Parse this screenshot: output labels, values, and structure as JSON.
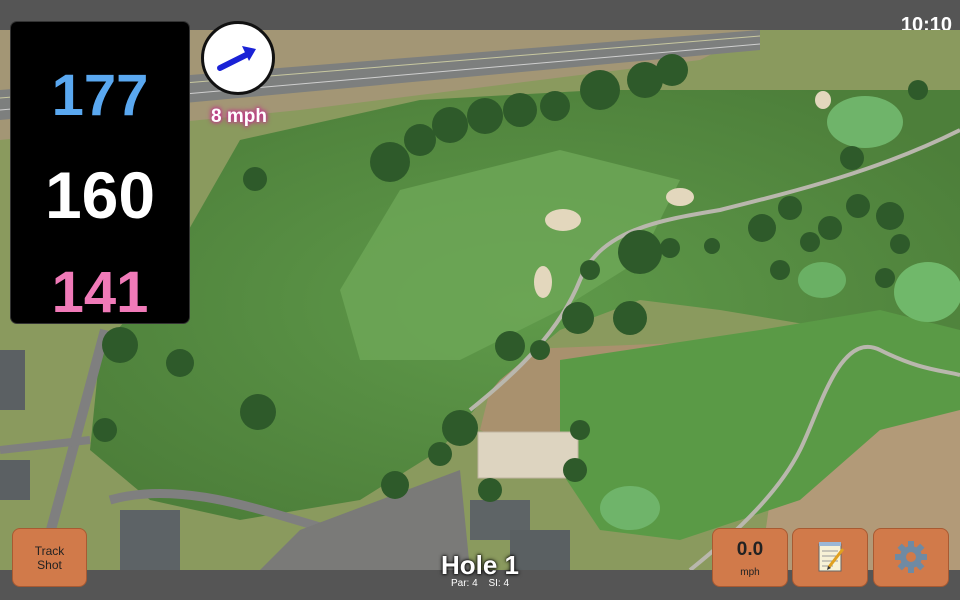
{
  "status": {
    "time": "10:10"
  },
  "distances": {
    "back": "177",
    "middle": "160",
    "front": "141"
  },
  "wind": {
    "speed_text": "8 mph",
    "direction_icon": "arrow-icon",
    "arrow_color": "#1a22d6"
  },
  "buttons": {
    "track_shot_label": "Track\nShot",
    "speed_value": "0.0",
    "speed_unit": "mph",
    "notes_icon": "notepad-icon",
    "settings_icon": "gear-icon"
  },
  "hole": {
    "title": "Hole 1",
    "par": "Par: 4",
    "si": "SI: 4"
  },
  "colors": {
    "back": "#5aa8f0",
    "middle": "#ffffff",
    "front": "#f07ab8",
    "button": "#d17a4a"
  }
}
